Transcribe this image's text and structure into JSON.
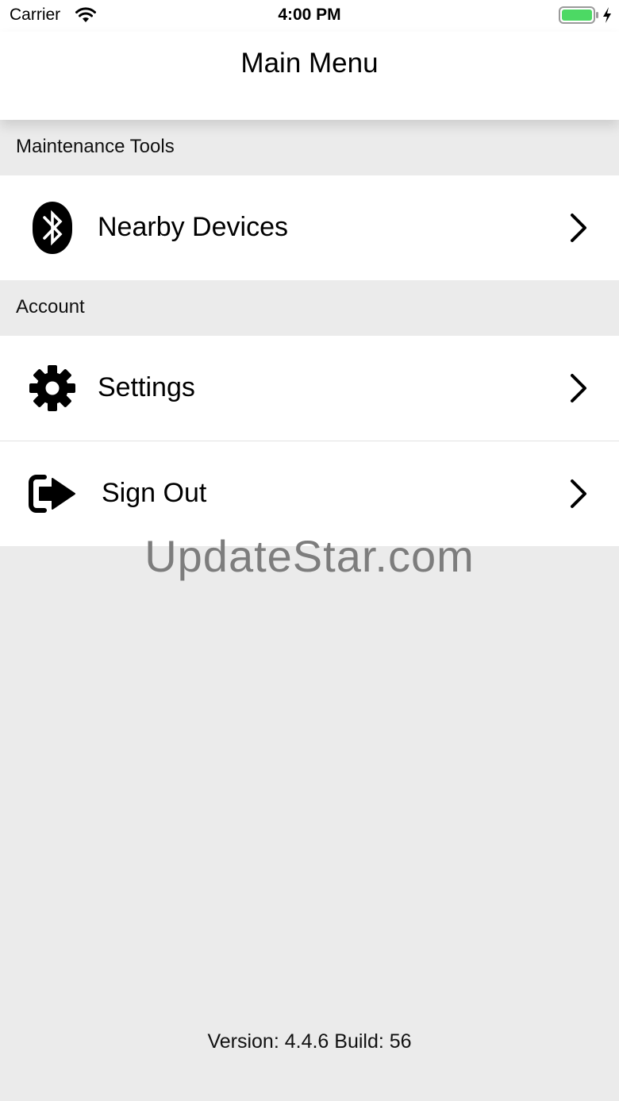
{
  "status_bar": {
    "carrier": "Carrier",
    "time": "4:00 PM",
    "battery_color": "#4cd964"
  },
  "nav": {
    "title": "Main Menu"
  },
  "sections": {
    "maintenance": {
      "header": "Maintenance Tools",
      "items": [
        {
          "label": "Nearby Devices",
          "icon": "bluetooth-icon"
        }
      ]
    },
    "account": {
      "header": "Account",
      "items": [
        {
          "label": "Settings",
          "icon": "gear-icon"
        },
        {
          "label": "Sign Out",
          "icon": "sign-out-icon"
        }
      ]
    }
  },
  "watermark": "UpdateStar.com",
  "footer": {
    "version": "Version: 4.4.6 Build: 56"
  }
}
